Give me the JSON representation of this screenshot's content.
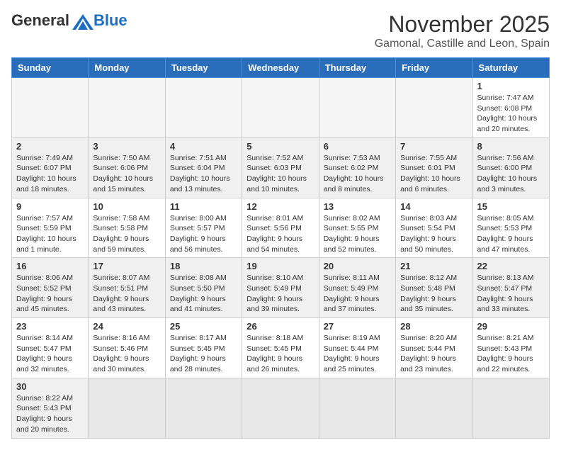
{
  "header": {
    "logo_general": "General",
    "logo_blue": "Blue",
    "month_title": "November 2025",
    "location": "Gamonal, Castille and Leon, Spain"
  },
  "weekdays": [
    "Sunday",
    "Monday",
    "Tuesday",
    "Wednesday",
    "Thursday",
    "Friday",
    "Saturday"
  ],
  "weeks": [
    [
      {
        "day": "",
        "empty": true
      },
      {
        "day": "",
        "empty": true
      },
      {
        "day": "",
        "empty": true
      },
      {
        "day": "",
        "empty": true
      },
      {
        "day": "",
        "empty": true
      },
      {
        "day": "",
        "empty": true
      },
      {
        "day": "1",
        "info": "Sunrise: 7:47 AM\nSunset: 6:08 PM\nDaylight: 10 hours\nand 20 minutes."
      }
    ],
    [
      {
        "day": "2",
        "info": "Sunrise: 7:49 AM\nSunset: 6:07 PM\nDaylight: 10 hours\nand 18 minutes."
      },
      {
        "day": "3",
        "info": "Sunrise: 7:50 AM\nSunset: 6:06 PM\nDaylight: 10 hours\nand 15 minutes."
      },
      {
        "day": "4",
        "info": "Sunrise: 7:51 AM\nSunset: 6:04 PM\nDaylight: 10 hours\nand 13 minutes."
      },
      {
        "day": "5",
        "info": "Sunrise: 7:52 AM\nSunset: 6:03 PM\nDaylight: 10 hours\nand 10 minutes."
      },
      {
        "day": "6",
        "info": "Sunrise: 7:53 AM\nSunset: 6:02 PM\nDaylight: 10 hours\nand 8 minutes."
      },
      {
        "day": "7",
        "info": "Sunrise: 7:55 AM\nSunset: 6:01 PM\nDaylight: 10 hours\nand 6 minutes."
      },
      {
        "day": "8",
        "info": "Sunrise: 7:56 AM\nSunset: 6:00 PM\nDaylight: 10 hours\nand 3 minutes."
      }
    ],
    [
      {
        "day": "9",
        "info": "Sunrise: 7:57 AM\nSunset: 5:59 PM\nDaylight: 10 hours\nand 1 minute."
      },
      {
        "day": "10",
        "info": "Sunrise: 7:58 AM\nSunset: 5:58 PM\nDaylight: 9 hours\nand 59 minutes."
      },
      {
        "day": "11",
        "info": "Sunrise: 8:00 AM\nSunset: 5:57 PM\nDaylight: 9 hours\nand 56 minutes."
      },
      {
        "day": "12",
        "info": "Sunrise: 8:01 AM\nSunset: 5:56 PM\nDaylight: 9 hours\nand 54 minutes."
      },
      {
        "day": "13",
        "info": "Sunrise: 8:02 AM\nSunset: 5:55 PM\nDaylight: 9 hours\nand 52 minutes."
      },
      {
        "day": "14",
        "info": "Sunrise: 8:03 AM\nSunset: 5:54 PM\nDaylight: 9 hours\nand 50 minutes."
      },
      {
        "day": "15",
        "info": "Sunrise: 8:05 AM\nSunset: 5:53 PM\nDaylight: 9 hours\nand 47 minutes."
      }
    ],
    [
      {
        "day": "16",
        "info": "Sunrise: 8:06 AM\nSunset: 5:52 PM\nDaylight: 9 hours\nand 45 minutes."
      },
      {
        "day": "17",
        "info": "Sunrise: 8:07 AM\nSunset: 5:51 PM\nDaylight: 9 hours\nand 43 minutes."
      },
      {
        "day": "18",
        "info": "Sunrise: 8:08 AM\nSunset: 5:50 PM\nDaylight: 9 hours\nand 41 minutes."
      },
      {
        "day": "19",
        "info": "Sunrise: 8:10 AM\nSunset: 5:49 PM\nDaylight: 9 hours\nand 39 minutes."
      },
      {
        "day": "20",
        "info": "Sunrise: 8:11 AM\nSunset: 5:49 PM\nDaylight: 9 hours\nand 37 minutes."
      },
      {
        "day": "21",
        "info": "Sunrise: 8:12 AM\nSunset: 5:48 PM\nDaylight: 9 hours\nand 35 minutes."
      },
      {
        "day": "22",
        "info": "Sunrise: 8:13 AM\nSunset: 5:47 PM\nDaylight: 9 hours\nand 33 minutes."
      }
    ],
    [
      {
        "day": "23",
        "info": "Sunrise: 8:14 AM\nSunset: 5:47 PM\nDaylight: 9 hours\nand 32 minutes."
      },
      {
        "day": "24",
        "info": "Sunrise: 8:16 AM\nSunset: 5:46 PM\nDaylight: 9 hours\nand 30 minutes."
      },
      {
        "day": "25",
        "info": "Sunrise: 8:17 AM\nSunset: 5:45 PM\nDaylight: 9 hours\nand 28 minutes."
      },
      {
        "day": "26",
        "info": "Sunrise: 8:18 AM\nSunset: 5:45 PM\nDaylight: 9 hours\nand 26 minutes."
      },
      {
        "day": "27",
        "info": "Sunrise: 8:19 AM\nSunset: 5:44 PM\nDaylight: 9 hours\nand 25 minutes."
      },
      {
        "day": "28",
        "info": "Sunrise: 8:20 AM\nSunset: 5:44 PM\nDaylight: 9 hours\nand 23 minutes."
      },
      {
        "day": "29",
        "info": "Sunrise: 8:21 AM\nSunset: 5:43 PM\nDaylight: 9 hours\nand 22 minutes."
      }
    ],
    [
      {
        "day": "30",
        "info": "Sunrise: 8:22 AM\nSunset: 5:43 PM\nDaylight: 9 hours\nand 20 minutes."
      },
      {
        "day": "",
        "empty": true
      },
      {
        "day": "",
        "empty": true
      },
      {
        "day": "",
        "empty": true
      },
      {
        "day": "",
        "empty": true
      },
      {
        "day": "",
        "empty": true
      },
      {
        "day": "",
        "empty": true
      }
    ]
  ]
}
